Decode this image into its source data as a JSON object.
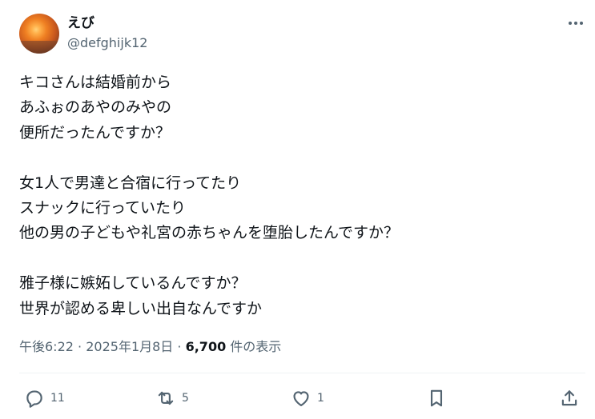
{
  "author": {
    "display_name": "えび",
    "handle": "@defghijk12"
  },
  "tweet": {
    "text": "キコさんは結婚前から\nあふぉのあやのみやの\n便所だったんですか？\n\n女1人で男達と合宿に行ってたり\nスナックに行っていたり\n他の男の子どもや礼宮の赤ちゃんを堕胎したんですか？\n\n雅子様に嫉妬しているんですか？\n世界が認める卑しい出自なんですか",
    "time": "午後6:22",
    "separator": "·",
    "date": "2025年1月8日",
    "views_count": "6,700",
    "views_label": "件の表示"
  },
  "actions": {
    "reply_count": "11",
    "repost_count": "5",
    "like_count": "1"
  },
  "icons": {
    "more": "more-horizontal-icon",
    "reply": "reply-icon",
    "repost": "repost-icon",
    "like": "heart-icon",
    "bookmark": "bookmark-icon",
    "share": "share-icon"
  },
  "colors": {
    "text_primary": "#0f1419",
    "text_secondary": "#536471",
    "divider": "#eff3f4"
  }
}
